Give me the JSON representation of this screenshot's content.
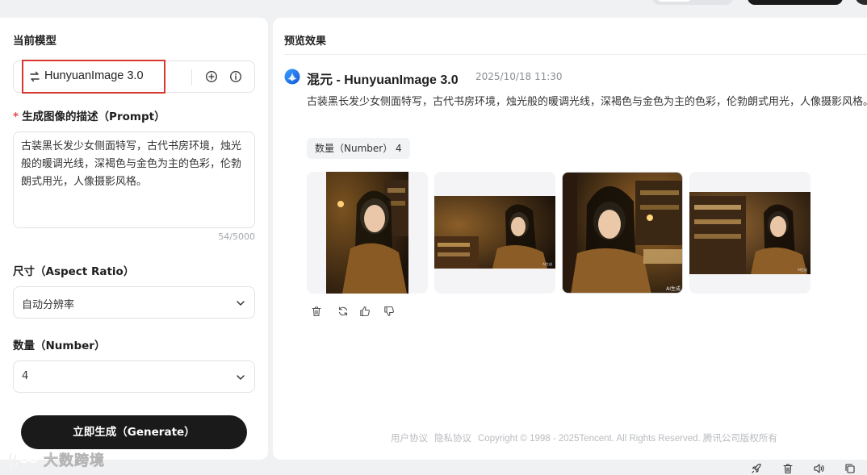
{
  "left": {
    "model_section_label": "当前模型",
    "model_name": "HunyuanImage 3.0",
    "prompt_label": "生成图像的描述（Prompt）",
    "prompt_required_mark": "*",
    "prompt_text": "古装黑长发少女侧面特写，古代书房环境，烛光般的暖调光线，深褐色与金色为主的色彩，伦勃朗式用光，人像摄影风格。",
    "char_count": "54/5000",
    "aspect_label": "尺寸（Aspect Ratio）",
    "aspect_value": "自动分辨率",
    "number_label": "数量（Number）",
    "number_value": "4",
    "generate_label": "立即生成（Generate）"
  },
  "right": {
    "preview_title": "预览效果",
    "result_title": "混元 - HunyuanImage 3.0",
    "result_time": "2025/10/18 11:30",
    "result_desc": "古装黑长发少女侧面特写，古代书房环境，烛光般的暖调光线，深褐色与金色为主的色彩，伦勃朗式用光，人像摄影风格。",
    "count_chip": "数量（Number）  4",
    "image_watermark": "AI生成",
    "footer": {
      "user_agreement": "用户协议",
      "privacy": "隐私协议",
      "copyright": "Copyright © 1998 - 2025Tencent. All Rights Reserved. 腾讯公司版权所有"
    }
  },
  "watermark": {
    "text": "大数跨境"
  },
  "icons": {
    "model": [
      "swap-icon",
      "add-circle-icon",
      "info-icon"
    ],
    "actions": [
      "trash-icon",
      "refresh-icon",
      "thumbs-up-icon",
      "thumbs-down-icon"
    ],
    "bottom_bar": [
      "rocket-icon",
      "trash-icon",
      "speaker-icon",
      "copy-icon"
    ]
  },
  "colors": {
    "primary_button": "#1a1a1a",
    "highlight_box": "#d9362f",
    "required_star": "#e5484d"
  }
}
